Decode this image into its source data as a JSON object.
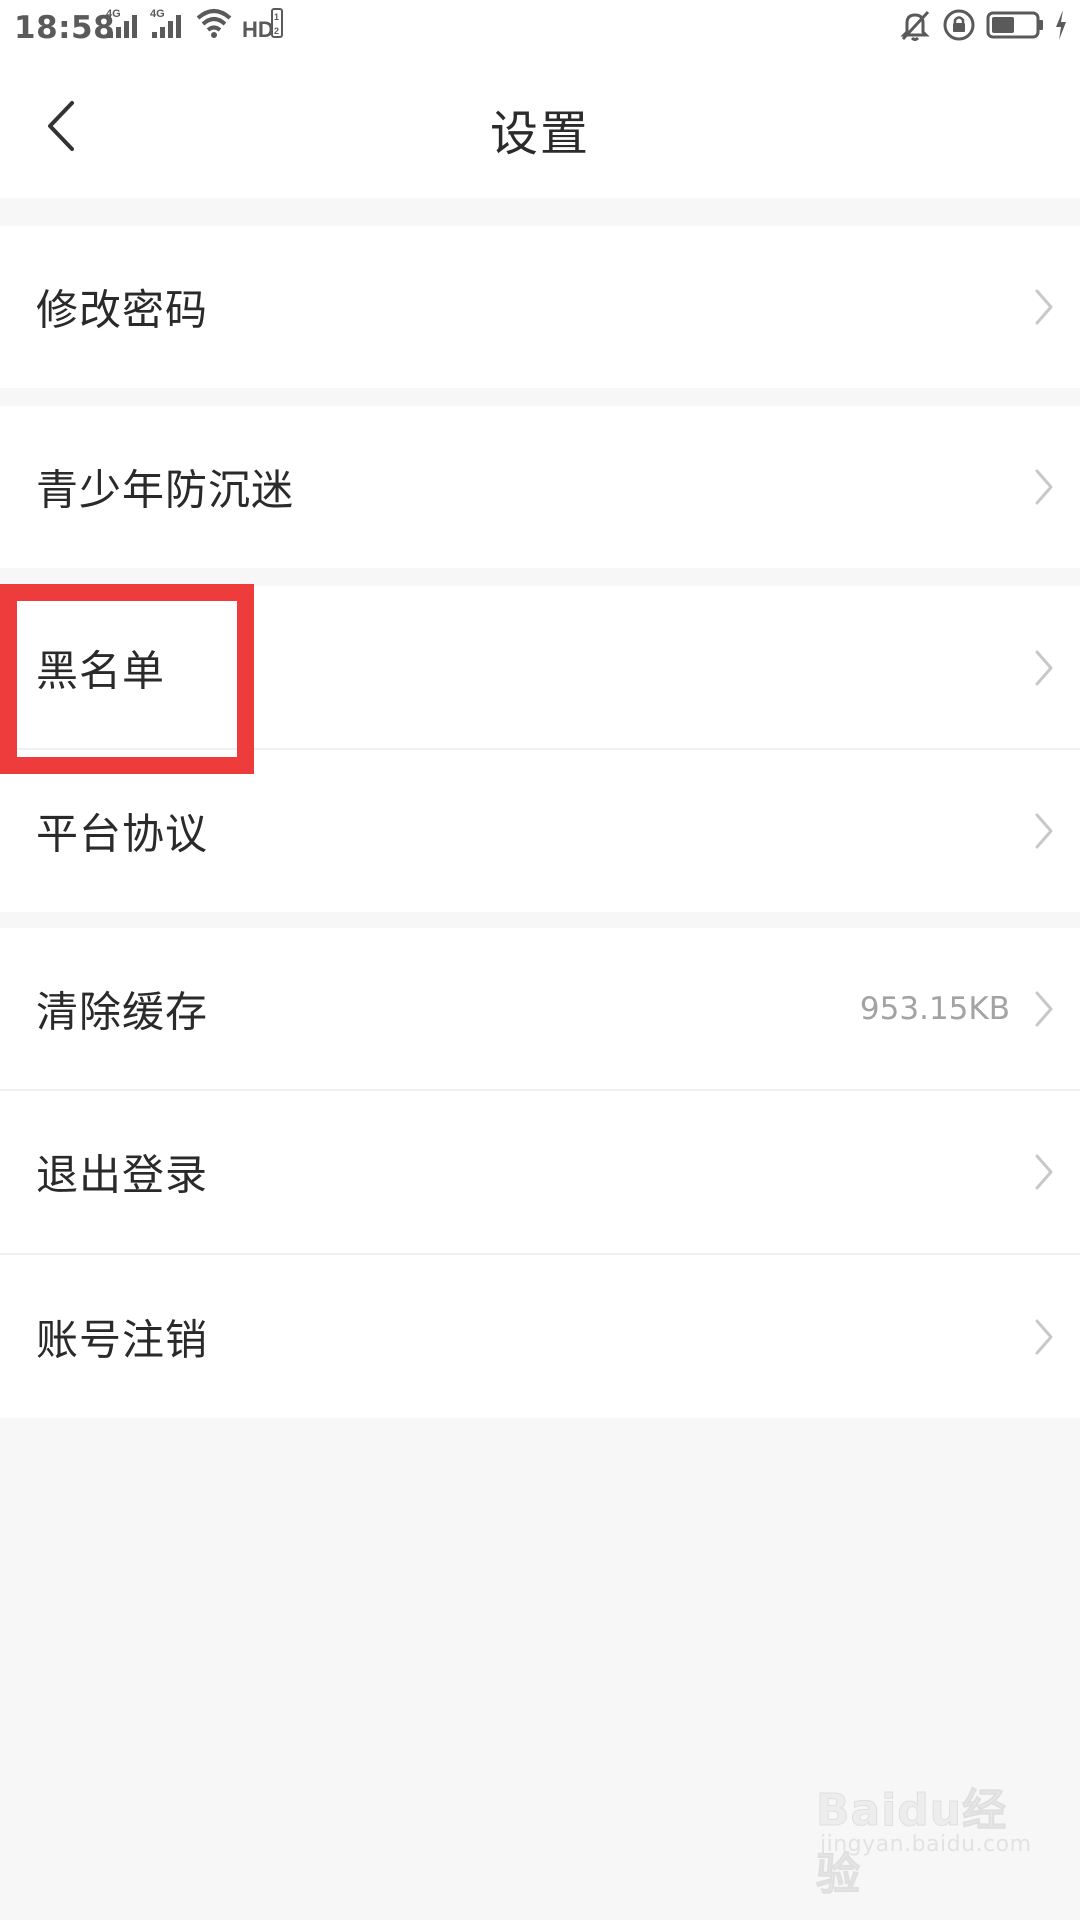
{
  "status_bar": {
    "time": "18:58",
    "net1": "4G",
    "net2": "4G",
    "hd": "HD",
    "icons": [
      "signal-icon",
      "signal-icon",
      "wifi-icon",
      "hd-icon",
      "bell-off-icon",
      "rotation-lock-icon",
      "battery-icon",
      "charging-icon"
    ]
  },
  "header": {
    "title": "设置",
    "back_icon": "chevron-left-icon"
  },
  "rows": [
    {
      "label": "修改密码"
    },
    {
      "label": "青少年防沉迷"
    },
    {
      "label": "黑名单"
    },
    {
      "label": "平台协议"
    },
    {
      "label": "清除缓存",
      "value": "953.15KB"
    },
    {
      "label": "退出登录"
    },
    {
      "label": "账号注销"
    }
  ],
  "highlight": {
    "color": "#ee3b3b"
  },
  "watermark": {
    "brand": "Baidu经验",
    "url": "jingyan.baidu.com"
  }
}
